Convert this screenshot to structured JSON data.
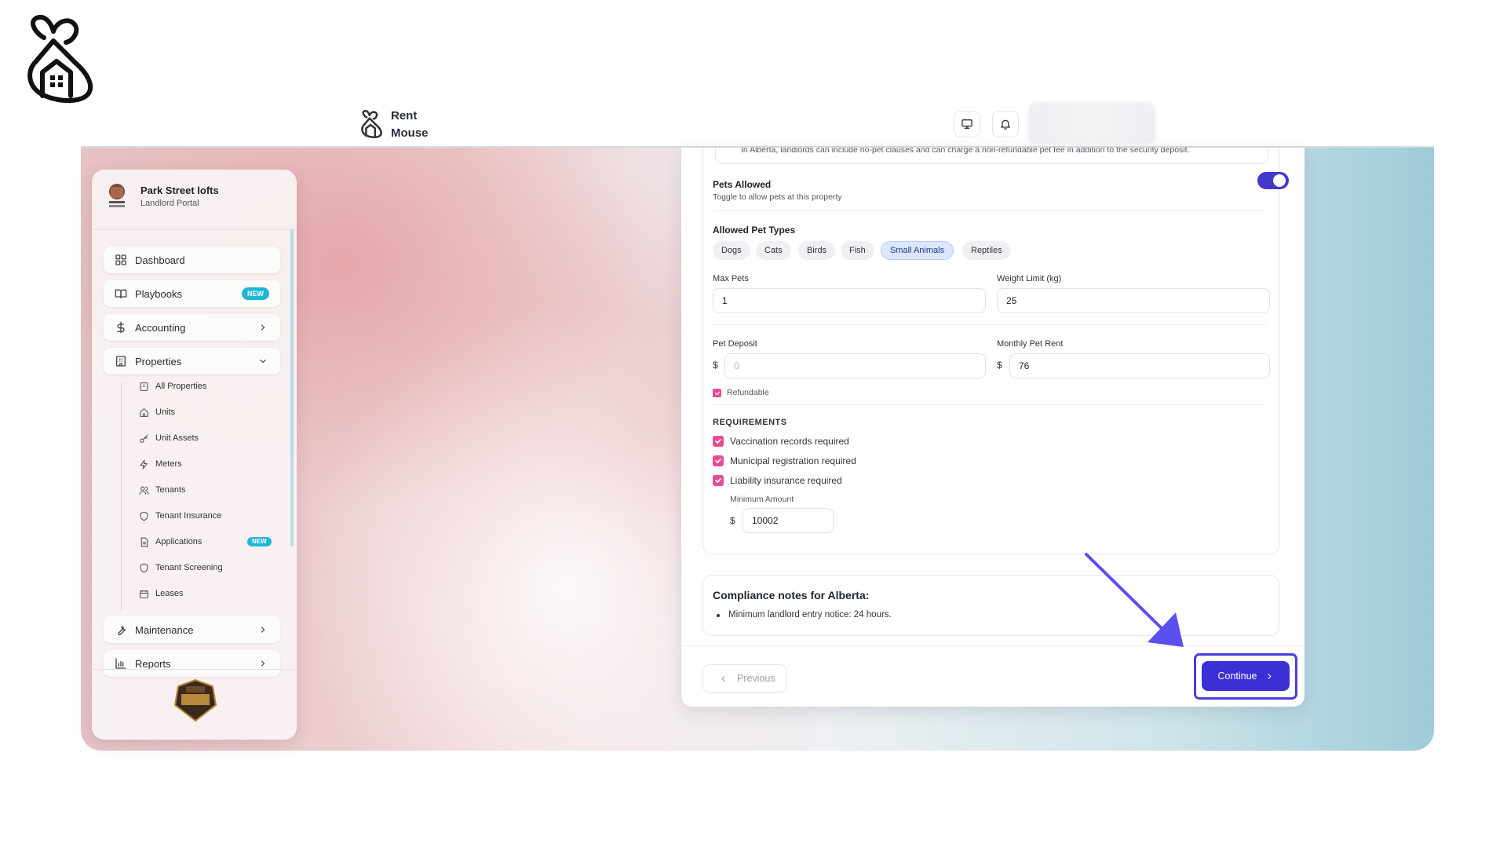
{
  "brand": {
    "logo_icon": "mouse-house-icon"
  },
  "topbar": {
    "app_name_line1": "Rent",
    "app_name_line2": "Mouse",
    "monitor_icon": "monitor-icon",
    "bell_icon": "bell-icon"
  },
  "sidebar": {
    "org_name": "Park Street lofts",
    "org_subtitle": "Landlord Portal",
    "items": [
      {
        "label": "Dashboard",
        "icon": "grid-icon"
      },
      {
        "label": "Playbooks",
        "icon": "book-icon",
        "badge": "NEW"
      },
      {
        "label": "Accounting",
        "icon": "dollar-icon"
      },
      {
        "label": "Properties",
        "icon": "building-icon"
      }
    ],
    "sub_items": [
      {
        "label": "All Properties",
        "icon": "building-icon"
      },
      {
        "label": "Units",
        "icon": "home-icon"
      },
      {
        "label": "Unit Assets",
        "icon": "key-icon"
      },
      {
        "label": "Meters",
        "icon": "bolt-icon"
      },
      {
        "label": "Tenants",
        "icon": "users-icon"
      },
      {
        "label": "Tenant Insurance",
        "icon": "shield-icon"
      },
      {
        "label": "Applications",
        "icon": "document-icon",
        "badge": "NEW"
      },
      {
        "label": "Tenant Screening",
        "icon": "shield-icon"
      },
      {
        "label": "Leases",
        "icon": "calendar-icon"
      }
    ],
    "bottom_items": [
      {
        "label": "Maintenance",
        "icon": "wrench-icon"
      },
      {
        "label": "Reports",
        "icon": "bar-chart-icon"
      }
    ],
    "badge_icon": "pro-founding-member-badge"
  },
  "form": {
    "notice": "In Alberta, landlords can include no-pet clauses and can charge a non-refundable pet fee in addition to the security deposit.",
    "pets_allowed_label": "Pets Allowed",
    "pets_allowed_hint": "Toggle to allow pets at this property",
    "pets_allowed_value": true,
    "allowed_types_label": "Allowed Pet Types",
    "pet_types": [
      "Dogs",
      "Cats",
      "Birds",
      "Fish",
      "Small Animals",
      "Reptiles"
    ],
    "active_pet_type": "Small Animals",
    "max_pets_label": "Max Pets",
    "max_pets_value": "1",
    "weight_limit_label": "Weight Limit (kg)",
    "weight_limit_value": "25",
    "pet_deposit_label": "Pet Deposit",
    "pet_deposit_placeholder": "0",
    "monthly_rent_label": "Monthly Pet Rent",
    "monthly_rent_value": "76",
    "currency": "$",
    "refundable_label": "Refundable",
    "requirements_heading": "REQUIREMENTS",
    "requirements": [
      "Vaccination records required",
      "Municipal registration required",
      "Liability insurance required"
    ],
    "minimum_amount_label": "Minimum Amount",
    "minimum_amount_value": "10002"
  },
  "compliance": {
    "title": "Compliance notes for Alberta:",
    "items": [
      "Minimum landlord entry notice: 24 hours."
    ]
  },
  "footer": {
    "previous_label": "Previous",
    "continue_label": "Continue"
  },
  "colors": {
    "accent": "#3b2fd6",
    "checkbox": "#e74c93",
    "badge": "#1fb6d6",
    "annotation_arrow": "#5b4ff0"
  }
}
